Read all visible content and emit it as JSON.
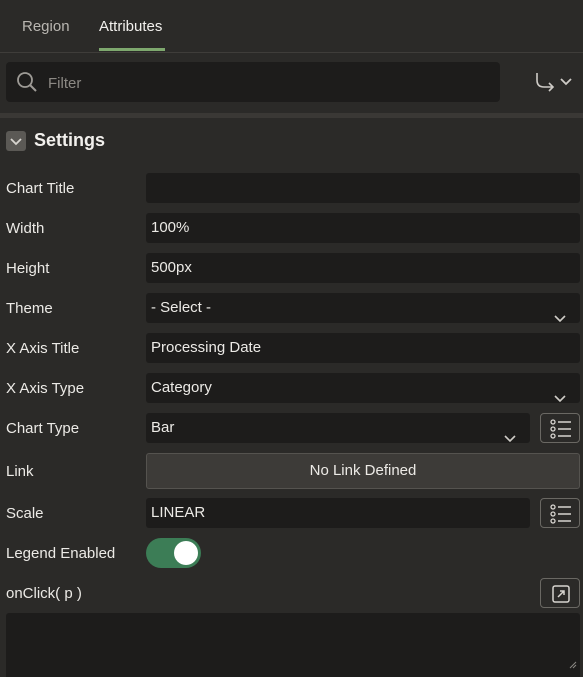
{
  "tabs": [
    {
      "label": "Region",
      "active": false
    },
    {
      "label": "Attributes",
      "active": true
    }
  ],
  "filter": {
    "placeholder": "Filter",
    "value": "",
    "icon": "search-icon",
    "goto_icon": "goto-group-icon"
  },
  "section": {
    "title": "Settings",
    "icon": "chevron-down-icon"
  },
  "fields": {
    "chart_title": {
      "label": "Chart Title",
      "value": ""
    },
    "width": {
      "label": "Width",
      "value": "100%"
    },
    "height": {
      "label": "Height",
      "value": "500px"
    },
    "theme": {
      "label": "Theme",
      "value": "- Select -"
    },
    "x_axis_title": {
      "label": "X Axis Title",
      "value": "Processing Date"
    },
    "x_axis_type": {
      "label": "X Axis Type",
      "value": "Category"
    },
    "chart_type": {
      "label": "Chart Type",
      "value": "Bar"
    },
    "link": {
      "label": "Link",
      "value": "No Link Defined"
    },
    "scale": {
      "label": "Scale",
      "value": "LINEAR"
    },
    "legend_enabled": {
      "label": "Legend Enabled",
      "value": true
    },
    "onclick": {
      "label": "onClick( p )",
      "value": ""
    }
  },
  "colors": {
    "accent": "#7ea86e",
    "toggle_on": "#3c7d56",
    "background": "#2b2a28",
    "field_bg": "#1d1c1b"
  }
}
